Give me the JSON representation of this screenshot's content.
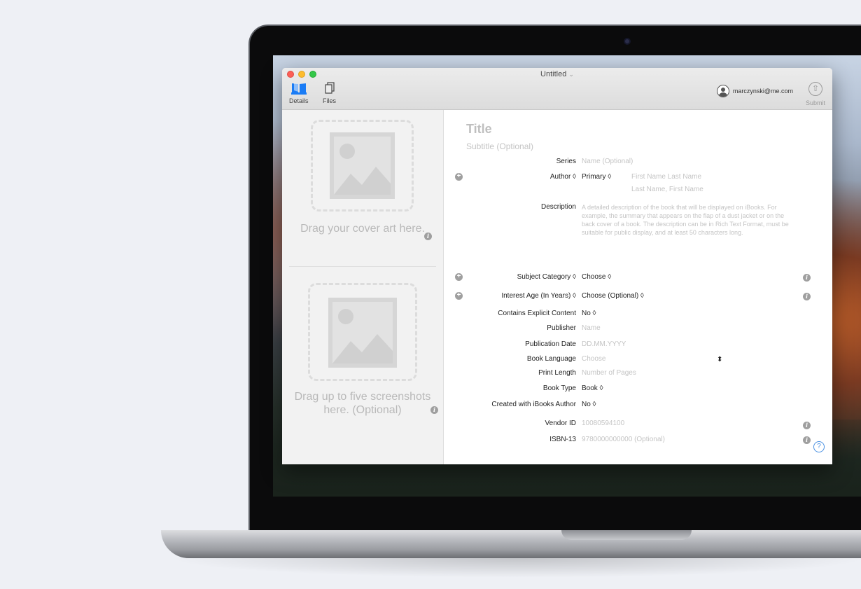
{
  "window": {
    "title": "Untitled",
    "title_chevron": "⌄"
  },
  "toolbar": {
    "details_label": "Details",
    "files_label": "Files",
    "account_email": "marczynski@me.com",
    "submit_label": "Submit"
  },
  "left_panel": {
    "cover_text": "Drag your cover art here.",
    "screenshots_text": "Drag up to five screenshots here. (Optional)"
  },
  "form": {
    "title_placeholder": "Title",
    "subtitle_placeholder": "Subtitle (Optional)",
    "series": {
      "label": "Series",
      "placeholder": "Name (Optional)"
    },
    "author": {
      "label": "Author ◊",
      "role": "Primary ◊",
      "name_placeholder": "First Name Last Name",
      "sort_placeholder": "Last Name, First Name"
    },
    "description": {
      "label": "Description",
      "placeholder": "A detailed description of the book that will be displayed on iBooks. For example, the summary that appears on the flap of a dust jacket or on the back cover of a book. The description can be in Rich Text Format, must be suitable for public display, and at least 50 characters long."
    },
    "subject_category": {
      "label": "Subject Category ◊",
      "value": "Choose ◊"
    },
    "interest_age": {
      "label": "Interest Age (In Years) ◊",
      "value": "Choose (Optional) ◊"
    },
    "explicit": {
      "label": "Contains Explicit Content",
      "value": "No ◊"
    },
    "publisher": {
      "label": "Publisher",
      "placeholder": "Name"
    },
    "publication_date": {
      "label": "Publication Date",
      "placeholder": "DD.MM.YYYY"
    },
    "book_language": {
      "label": "Book Language",
      "placeholder": "Choose",
      "stepper": "⬍"
    },
    "print_length": {
      "label": "Print Length",
      "placeholder": "Number of Pages"
    },
    "book_type": {
      "label": "Book Type",
      "value": "Book ◊"
    },
    "ibooks_author": {
      "label": "Created with iBooks Author",
      "value": "No ◊"
    },
    "vendor_id": {
      "label": "Vendor ID",
      "placeholder": "10080594100"
    },
    "isbn": {
      "label": "ISBN-13",
      "placeholder": "9780000000000 (Optional)"
    }
  },
  "icons": {
    "plus": "+",
    "info": "i",
    "help": "?",
    "submit_arrow": "⇧"
  }
}
